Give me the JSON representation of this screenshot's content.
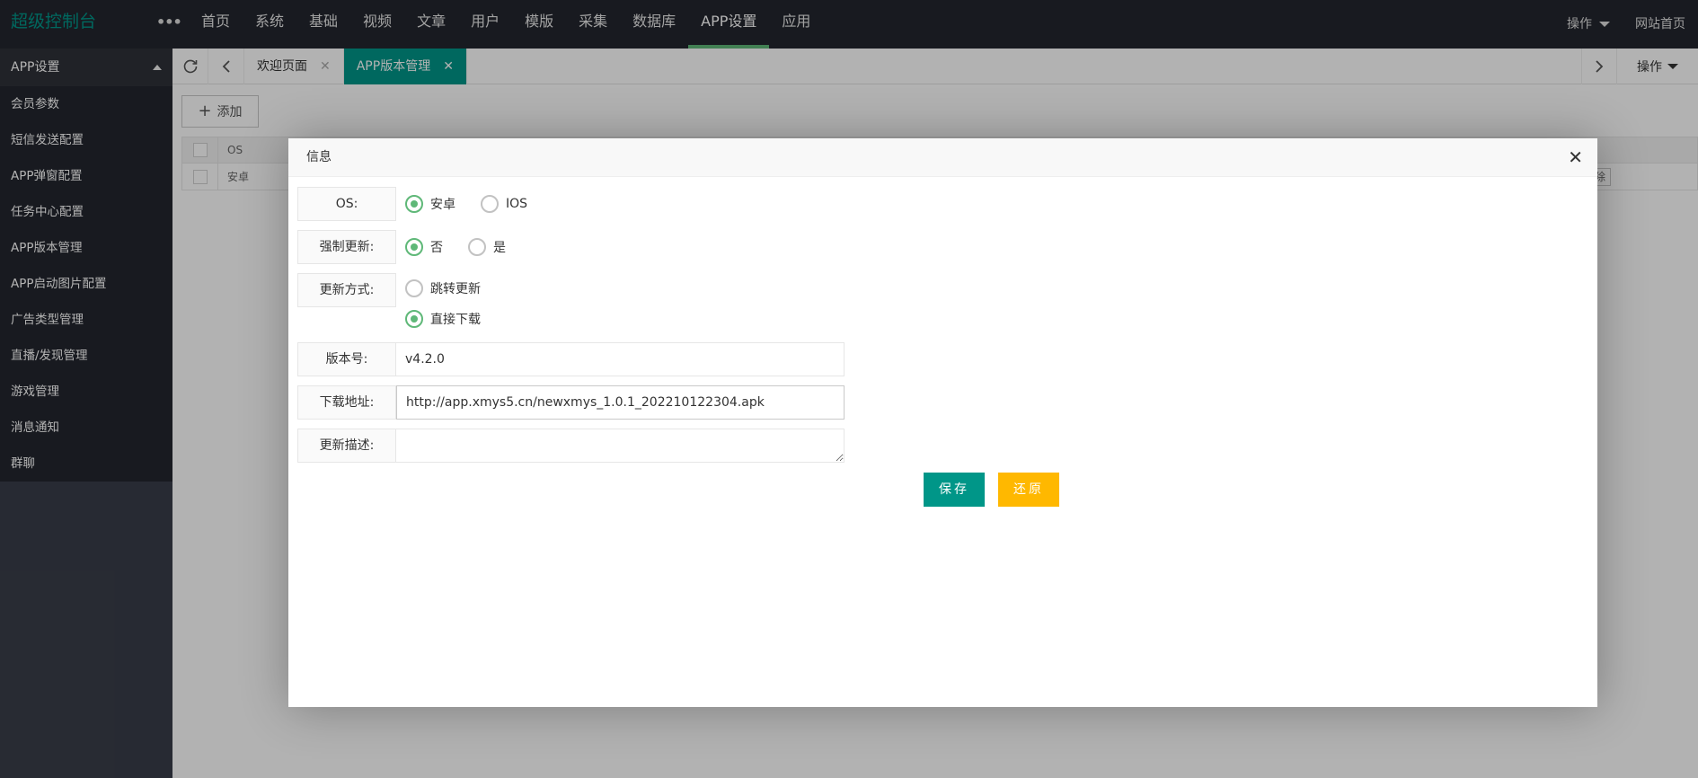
{
  "header": {
    "logo": "超级控制台",
    "more": "•••",
    "nav": [
      {
        "label": "首页",
        "active": false
      },
      {
        "label": "系统",
        "active": false
      },
      {
        "label": "基础",
        "active": false
      },
      {
        "label": "视频",
        "active": false
      },
      {
        "label": "文章",
        "active": false
      },
      {
        "label": "用户",
        "active": false
      },
      {
        "label": "模版",
        "active": false
      },
      {
        "label": "采集",
        "active": false
      },
      {
        "label": "数据库",
        "active": false
      },
      {
        "label": "APP设置",
        "active": true
      },
      {
        "label": "应用",
        "active": false
      }
    ],
    "ops_label": "操作",
    "home_link": "网站首页"
  },
  "sidebar": {
    "group_title": "APP设置",
    "items": [
      {
        "label": "会员参数"
      },
      {
        "label": "短信发送配置"
      },
      {
        "label": "APP弹窗配置"
      },
      {
        "label": "任务中心配置"
      },
      {
        "label": "APP版本管理"
      },
      {
        "label": "APP启动图片配置"
      },
      {
        "label": "广告类型管理"
      },
      {
        "label": "直播/发现管理"
      },
      {
        "label": "游戏管理"
      },
      {
        "label": "消息通知"
      },
      {
        "label": "群聊"
      }
    ]
  },
  "tabbar": {
    "tabs": [
      {
        "label": "欢迎页面",
        "active": false
      },
      {
        "label": "APP版本管理",
        "active": true
      }
    ],
    "ops_label": "操作"
  },
  "main": {
    "add_button": "添加",
    "table_header_os": "OS",
    "row_os": "安卓",
    "row_delete_fragment": "除"
  },
  "modal": {
    "title": "信息",
    "close": "✕",
    "os": {
      "label": "OS:",
      "options": [
        {
          "label": "安卓",
          "checked": true
        },
        {
          "label": "IOS",
          "checked": false
        }
      ]
    },
    "force_update": {
      "label": "强制更新:",
      "options": [
        {
          "label": "否",
          "checked": true
        },
        {
          "label": "是",
          "checked": false
        }
      ]
    },
    "update_method": {
      "label": "更新方式:",
      "options": [
        {
          "label": "跳转更新",
          "checked": false
        },
        {
          "label": "直接下载",
          "checked": true
        }
      ]
    },
    "version": {
      "label": "版本号:",
      "value": "v4.2.0"
    },
    "download_url": {
      "label": "下载地址:",
      "value": "http://app.xmys5.cn/newxmys_1.0.1_202210122304.apk"
    },
    "description": {
      "label": "更新描述:",
      "value": ""
    },
    "save_button": "保存",
    "reset_button": "还原"
  },
  "colors": {
    "accent": "#009688",
    "radio_checked": "#5fb878",
    "reset": "#ffb800",
    "header_bg": "#23262e"
  }
}
